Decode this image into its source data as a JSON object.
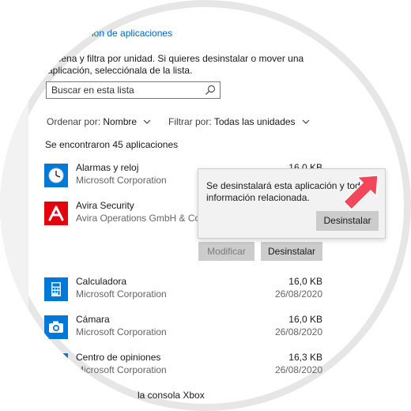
{
  "header": {
    "link_text": "ión de aplicaciones",
    "description": "ordena y filtra por unidad. Si quieres desinstalar o mover una aplicación, selecciónala de la lista."
  },
  "search": {
    "placeholder": "Buscar en esta lista",
    "icon": "search-icon"
  },
  "sort": {
    "label": "Ordenar por:",
    "value": "Nombre"
  },
  "filter": {
    "label": "Filtrar por:",
    "value": "Todas las unidades"
  },
  "count_text": "Se encontraron 45 aplicaciones",
  "apps": [
    {
      "name": "Alarmas y reloj",
      "publisher": "Microsoft Corporation",
      "size": "16,0 KB",
      "date": "",
      "icon": "clock-icon"
    },
    {
      "name": "Avira Security",
      "publisher": "Avira Operations GmbH & Co. K",
      "size": "",
      "date": "",
      "icon": "avira-icon"
    },
    {
      "name": "Calculadora",
      "publisher": "Microsoft Corporation",
      "size": "16,0 KB",
      "date": "26/08/2020",
      "icon": "calculator-icon"
    },
    {
      "name": "Cámara",
      "publisher": "Microsoft Corporation",
      "size": "16,0 KB",
      "date": "26/08/2020",
      "icon": "camera-icon"
    },
    {
      "name": "Centro de opiniones",
      "publisher": "Microsoft Corporation",
      "size": "16,3 KB",
      "date": "26/08/2020",
      "icon": "feedback-icon"
    },
    {
      "name": "la consola Xbox",
      "publisher": "",
      "size": "",
      "date": "",
      "icon": ""
    }
  ],
  "actions": {
    "modify": "Modificar",
    "uninstall": "Desinstalar"
  },
  "popup": {
    "message": "Se desinstalará esta aplicación y toda la información relacionada.",
    "confirm": "Desinstalar"
  },
  "colors": {
    "accent": "#0067c0",
    "avira_red": "#e3000f",
    "arrow": "#f0475a"
  }
}
